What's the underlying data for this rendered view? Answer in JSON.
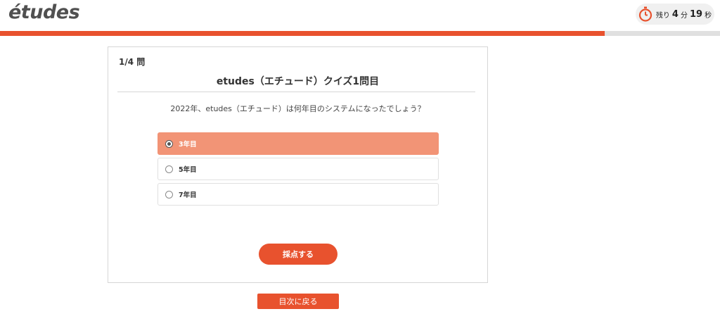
{
  "header": {
    "logo": "étude​s",
    "timer": {
      "prefix": "残り",
      "minutes": "4",
      "minutes_unit": "分",
      "seconds": "19",
      "seconds_unit": "秒"
    },
    "progress": 0.84
  },
  "quiz": {
    "count": "1/4 問",
    "title": "etudes（エチュード）クイズ1問目",
    "question": "2022年、etudes（エチュード）は何年目のシステムになったでしょう？",
    "options": [
      {
        "label": "3年目",
        "selected": true
      },
      {
        "label": "5年目",
        "selected": false
      },
      {
        "label": "7年目",
        "selected": false
      }
    ],
    "submit_label": "採点する"
  },
  "footer": {
    "back_label": "目次に戻る"
  },
  "colors": {
    "accent": "#e8522e",
    "selected_option": "#f29476"
  }
}
